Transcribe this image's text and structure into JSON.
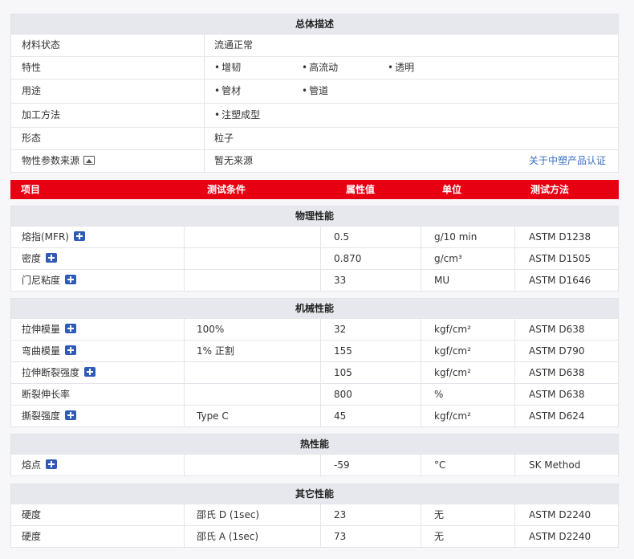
{
  "overview": {
    "title": "总体描述",
    "rows": {
      "state": {
        "label": "材料状态",
        "value": "流通正常"
      },
      "features": {
        "label": "特性",
        "items": [
          "增韧",
          "高流动",
          "透明"
        ]
      },
      "uses": {
        "label": "用途",
        "items": [
          "管材",
          "管道"
        ]
      },
      "processing": {
        "label": "加工方法",
        "items": [
          "注塑成型"
        ]
      },
      "form": {
        "label": "形态",
        "value": "粒子"
      },
      "source": {
        "label": "物性参数来源",
        "value": "暂无来源",
        "link": "关于中塑产品认证"
      }
    },
    "bullet": "•"
  },
  "columns": {
    "item": "项目",
    "condition": "测试条件",
    "value": "属性值",
    "unit": "单位",
    "method": "测试方法"
  },
  "sections": {
    "physical": {
      "title": "物理性能",
      "rows": [
        {
          "name": "熔指(MFR)",
          "condition": "",
          "value": "0.5",
          "unit": "g/10 min",
          "method": "ASTM D1238"
        },
        {
          "name": "密度",
          "condition": "",
          "value": "0.870",
          "unit": "g/cm³",
          "method": "ASTM D1505"
        },
        {
          "name": "门尼粘度",
          "condition": "",
          "value": "33",
          "unit": "MU",
          "method": "ASTM D1646"
        }
      ]
    },
    "mechanical": {
      "title": "机械性能",
      "rows": [
        {
          "name": "拉伸模量",
          "condition": "100%",
          "value": "32",
          "unit": "kgf/cm²",
          "method": "ASTM D638"
        },
        {
          "name": "弯曲模量",
          "condition": "1% 正割",
          "value": "155",
          "unit": "kgf/cm²",
          "method": "ASTM D790"
        },
        {
          "name": "拉伸断裂强度",
          "condition": "",
          "value": "105",
          "unit": "kgf/cm²",
          "method": "ASTM D638"
        },
        {
          "name": "断裂伸长率",
          "condition": "",
          "value": "800",
          "unit": "%",
          "method": "ASTM D638"
        },
        {
          "name": "撕裂强度",
          "condition": "Type C",
          "value": "45",
          "unit": "kgf/cm²",
          "method": "ASTM D624"
        }
      ]
    },
    "thermal": {
      "title": "热性能",
      "rows": [
        {
          "name": "熔点",
          "condition": "",
          "value": "-59",
          "unit": "°C",
          "method": "SK Method"
        }
      ]
    },
    "other": {
      "title": "其它性能",
      "rows": [
        {
          "name": "硬度",
          "condition": "邵氏 D (1sec)",
          "value": "23",
          "unit": "无",
          "method": "ASTM D2240"
        },
        {
          "name": "硬度",
          "condition": "邵氏 A (1sec)",
          "value": "73",
          "unit": "无",
          "method": "ASTM D2240"
        }
      ]
    }
  },
  "colors": {
    "header_red": "#e60012",
    "section_gray": "#e6e8ed",
    "link_blue": "#3a6fc7",
    "icon_blue": "#2f5bb6"
  }
}
